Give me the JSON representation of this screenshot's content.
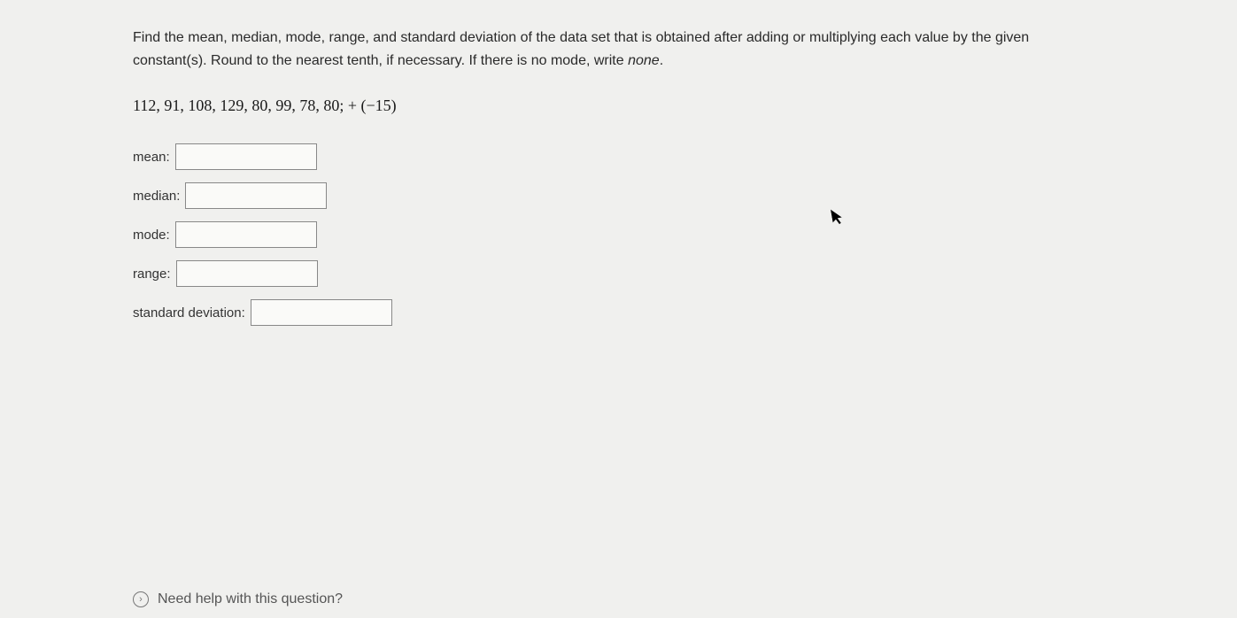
{
  "question": {
    "instructions_part1": "Find the mean, median, mode, range, and standard deviation of the data set that is obtained after adding or multiplying each value by the given constant(s). Round to the nearest tenth, if necessary. If there is no mode, write ",
    "instructions_italic": "none",
    "instructions_part2": ".",
    "data_set": "112, 91, 108, 129, 80, 99, 78, 80;  + (−15)"
  },
  "fields": {
    "mean": {
      "label": "mean:",
      "value": ""
    },
    "median": {
      "label": "median:",
      "value": ""
    },
    "mode": {
      "label": "mode:",
      "value": ""
    },
    "range": {
      "label": "range:",
      "value": ""
    },
    "std_dev": {
      "label": "standard deviation:",
      "value": ""
    }
  },
  "help": {
    "text": "Need help with this question?",
    "icon_glyph": "›"
  }
}
